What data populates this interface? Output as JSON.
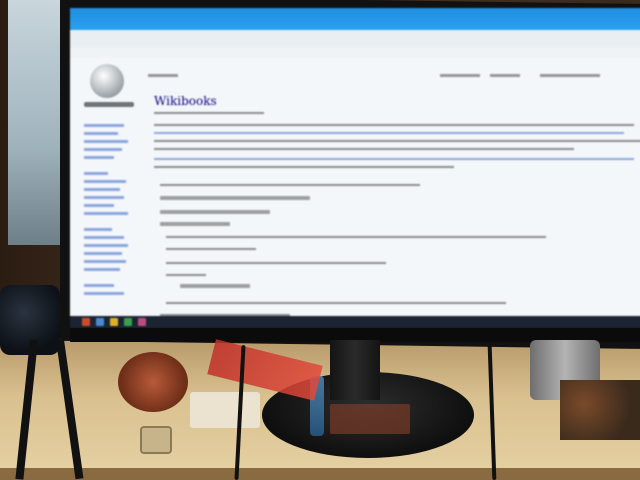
{
  "scene": {
    "description_type": "blurry photo of a desktop monitor showing a Wikipedia article in a browser",
    "colors": {
      "browser_chrome": "#1f8ee0",
      "page_background": "#f4f7f9",
      "link_blue": "#3366cc",
      "desk": "#d9c08f",
      "monitor": "#111111"
    }
  },
  "browser": {
    "page_title": "Wikibooks"
  },
  "icons": {
    "wiki_logo": "wikipedia-globe-icon"
  }
}
